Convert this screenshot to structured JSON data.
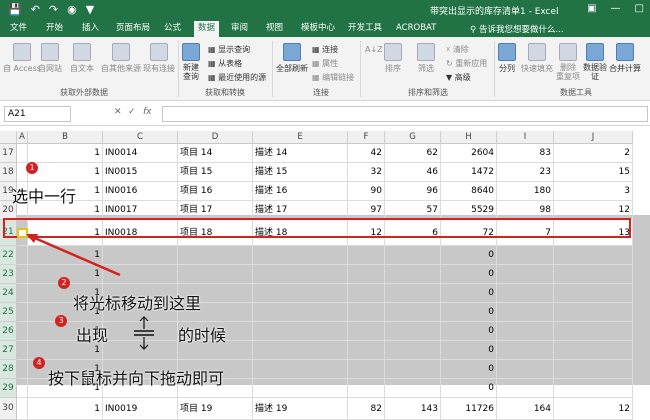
{
  "titlebar": {
    "title": "带突出显示的库存清单1 - Excel",
    "qat_icons": [
      "save-icon",
      "undo-icon",
      "redo-icon",
      "camera-icon",
      "filter-qat-icon"
    ]
  },
  "tabs": [
    "文件",
    "开始",
    "插入",
    "页面布局",
    "公式",
    "数据",
    "审阅",
    "视图",
    "模板中心",
    "开发工具",
    "ACROBAT"
  ],
  "active_tab": "数据",
  "tell_me": "告诉我您想要做什么...",
  "ribbon": {
    "get_external": [
      "自 Access",
      "自网站",
      "自文本",
      "自其他来源",
      "现有连接"
    ],
    "get_external_label": "获取外部数据",
    "new_query": "新建\n查询",
    "show_queries": "显示查询",
    "from_table": "从表格",
    "recent_sources": "最近使用的源",
    "get_transform_label": "获取和转换",
    "refresh_all": "全部刷新",
    "connections": "连接",
    "properties": "属性",
    "edit_links": "编辑链接",
    "connections_label": "连接",
    "sort_az": "A↓Z",
    "sort": "排序",
    "filter": "筛选",
    "clear": "清除",
    "reapply": "重新应用",
    "advanced": "高级",
    "sort_filter_label": "排序和筛选",
    "split": "分列",
    "flash_fill": "快速填充",
    "remove_dup": "删除\n重复项",
    "validation": "数据验\n证",
    "consolidate": "合并计算",
    "data_tools_label": "数据工具"
  },
  "name_box": "A21",
  "fx": "fx",
  "columns": [
    "A",
    "B",
    "C",
    "D",
    "E",
    "F",
    "G",
    "H",
    "I",
    "J"
  ],
  "rows": [
    {
      "row": "17",
      "b": "1",
      "c": "IN0014",
      "d": "项目 14",
      "e": "描述 14",
      "f": "42",
      "g": "62",
      "h": "2604",
      "i": "83",
      "j": "2"
    },
    {
      "row": "18",
      "b": "1",
      "c": "IN0015",
      "d": "项目 15",
      "e": "描述 15",
      "f": "32",
      "g": "46",
      "h": "1472",
      "i": "23",
      "j": "15"
    },
    {
      "row": "19",
      "b": "1",
      "c": "IN0016",
      "d": "项目 16",
      "e": "描述 16",
      "f": "90",
      "g": "96",
      "h": "8640",
      "i": "180",
      "j": "3"
    },
    {
      "row": "20",
      "b": "1",
      "c": "IN0017",
      "d": "项目 17",
      "e": "描述 17",
      "f": "97",
      "g": "57",
      "h": "5529",
      "i": "98",
      "j": "12"
    },
    {
      "row": "21",
      "b": "1",
      "c": "IN0018",
      "d": "项目 18",
      "e": "描述 18",
      "f": "12",
      "g": "6",
      "h": "72",
      "i": "7",
      "j": "13"
    },
    {
      "row": "22",
      "b": "1",
      "c": "",
      "d": "",
      "e": "",
      "f": "",
      "g": "",
      "h": "0",
      "i": "",
      "j": ""
    },
    {
      "row": "23",
      "b": "1",
      "c": "",
      "d": "",
      "e": "",
      "f": "",
      "g": "",
      "h": "0",
      "i": "",
      "j": ""
    },
    {
      "row": "24",
      "b": "1",
      "c": "",
      "d": "",
      "e": "",
      "f": "",
      "g": "",
      "h": "0",
      "i": "",
      "j": ""
    },
    {
      "row": "25",
      "b": "1",
      "c": "",
      "d": "",
      "e": "",
      "f": "",
      "g": "",
      "h": "0",
      "i": "",
      "j": ""
    },
    {
      "row": "26",
      "b": "1",
      "c": "",
      "d": "",
      "e": "",
      "f": "",
      "g": "",
      "h": "0",
      "i": "",
      "j": ""
    },
    {
      "row": "27",
      "b": "1",
      "c": "",
      "d": "",
      "e": "",
      "f": "",
      "g": "",
      "h": "0",
      "i": "",
      "j": ""
    },
    {
      "row": "28",
      "b": "1",
      "c": "",
      "d": "",
      "e": "",
      "f": "",
      "g": "",
      "h": "0",
      "i": "",
      "j": ""
    },
    {
      "row": "29",
      "b": "1",
      "c": "",
      "d": "",
      "e": "",
      "f": "",
      "g": "",
      "h": "0",
      "i": "",
      "j": ""
    },
    {
      "row": "30",
      "b": "1",
      "c": "IN0019",
      "d": "项目 19",
      "e": "描述 19",
      "f": "82",
      "g": "143",
      "h": "11726",
      "i": "164",
      "j": "12"
    }
  ],
  "annotations": {
    "step1": "选中一行",
    "step2": "将光标移动到这里",
    "step3a": "出现",
    "step3b": "的时候",
    "step4": "按下鼠标并向下拖动即可",
    "badges": [
      "1",
      "2",
      "3",
      "4"
    ]
  },
  "colors": {
    "excel_green": "#217346",
    "annotation_red": "#d32222",
    "highlight": "#e8c21a"
  }
}
